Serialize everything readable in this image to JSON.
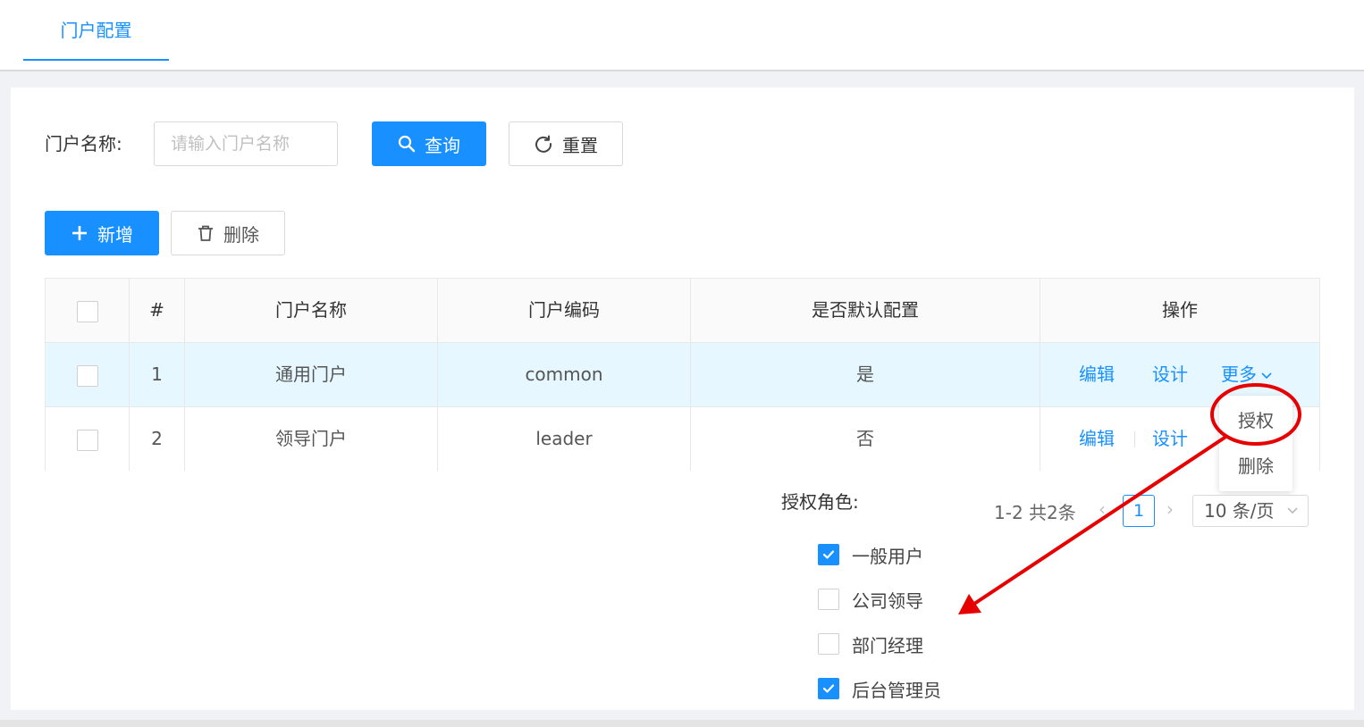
{
  "header": {
    "tab_label": "门户配置"
  },
  "search": {
    "name_label": "门户名称:",
    "name_placeholder": "请输入门户名称",
    "query_label": "查询",
    "reset_label": "重置"
  },
  "toolbar": {
    "add_label": "新增",
    "delete_label": "删除"
  },
  "table": {
    "columns": [
      "#",
      "门户名称",
      "门户编码",
      "是否默认配置",
      "操作"
    ],
    "rows": [
      {
        "index": "1",
        "name": "通用门户",
        "code": "common",
        "default": "是"
      },
      {
        "index": "2",
        "name": "领导门户",
        "code": "leader",
        "default": "否"
      }
    ],
    "actions": {
      "edit": "编辑",
      "design": "设计",
      "more": "更多"
    }
  },
  "more_menu": {
    "items": [
      "授权",
      "删除"
    ]
  },
  "authorization": {
    "label": "授权角色:",
    "roles": [
      {
        "name": "一般用户",
        "checked": true
      },
      {
        "name": "公司领导",
        "checked": false
      },
      {
        "name": "部门经理",
        "checked": false
      },
      {
        "name": "后台管理员",
        "checked": true
      }
    ]
  },
  "pagination": {
    "total_text": "1-2 共2条",
    "current_page": "1",
    "page_size": "10 条/页"
  },
  "colors": {
    "primary": "#1890ff",
    "row_highlight": "#e6f7ff",
    "annotation": "#e60000"
  }
}
